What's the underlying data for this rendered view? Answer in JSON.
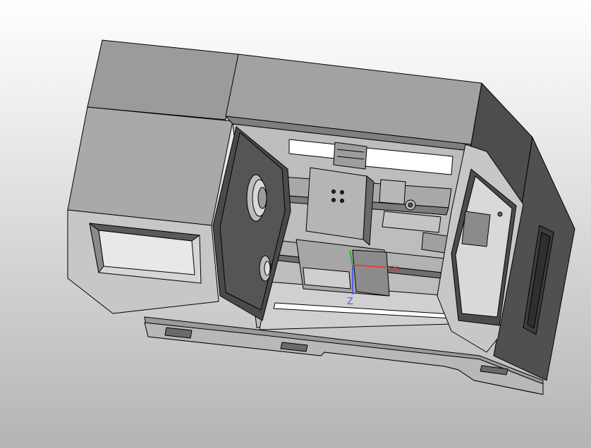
{
  "viewport": {
    "background_top": "#ffffff",
    "background_bottom": "#b4b4b4"
  },
  "model": {
    "shade_dark": "#4a4a4a",
    "shade_mid": "#8f8f8f",
    "shade_light": "#c2c2c2",
    "edge_color": "#000000"
  },
  "axis_triad": {
    "x_label": "X",
    "z_label": "Z",
    "x_color": "#e04040",
    "y_color": "#30b030",
    "z_color": "#5060e0"
  }
}
